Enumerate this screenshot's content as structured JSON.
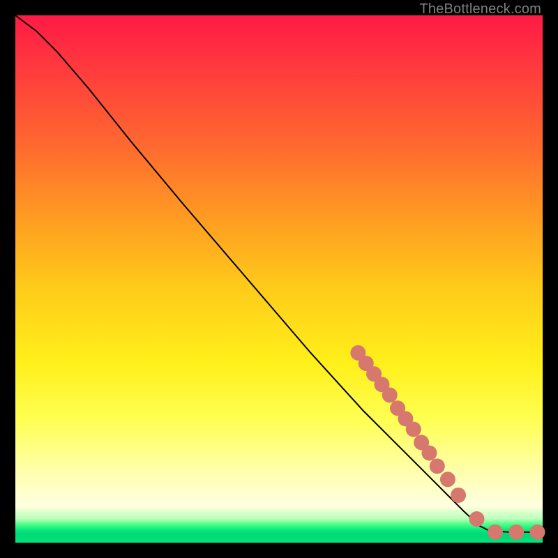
{
  "watermark": "TheBottleneck.com",
  "chart_data": {
    "type": "line",
    "title": "",
    "xlabel": "",
    "ylabel": "",
    "xlim": [
      0,
      100
    ],
    "ylim": [
      0,
      100
    ],
    "curve": [
      {
        "x": 0,
        "y": 100
      },
      {
        "x": 4,
        "y": 97
      },
      {
        "x": 8,
        "y": 93
      },
      {
        "x": 14,
        "y": 86
      },
      {
        "x": 22,
        "y": 76
      },
      {
        "x": 32,
        "y": 64
      },
      {
        "x": 44,
        "y": 50
      },
      {
        "x": 56,
        "y": 36
      },
      {
        "x": 66,
        "y": 25
      },
      {
        "x": 74,
        "y": 17
      },
      {
        "x": 80,
        "y": 11
      },
      {
        "x": 85,
        "y": 6
      },
      {
        "x": 88,
        "y": 3.2
      },
      {
        "x": 90,
        "y": 2.2
      },
      {
        "x": 94,
        "y": 2.0
      },
      {
        "x": 97,
        "y": 2.0
      },
      {
        "x": 100,
        "y": 2.0
      }
    ],
    "markers": [
      {
        "x": 65,
        "y": 36
      },
      {
        "x": 66.5,
        "y": 34
      },
      {
        "x": 68,
        "y": 32
      },
      {
        "x": 69.5,
        "y": 30
      },
      {
        "x": 71,
        "y": 28
      },
      {
        "x": 72.5,
        "y": 25.5
      },
      {
        "x": 74,
        "y": 23.5
      },
      {
        "x": 75.5,
        "y": 21.5
      },
      {
        "x": 77,
        "y": 19
      },
      {
        "x": 78.5,
        "y": 17
      },
      {
        "x": 80,
        "y": 14.5
      },
      {
        "x": 82,
        "y": 12
      },
      {
        "x": 84,
        "y": 9
      },
      {
        "x": 87.5,
        "y": 4.5
      },
      {
        "x": 91,
        "y": 2.0
      },
      {
        "x": 95,
        "y": 2.0
      },
      {
        "x": 99,
        "y": 2.0
      }
    ],
    "marker_color": "#d6786e",
    "curve_color": "#000000"
  }
}
